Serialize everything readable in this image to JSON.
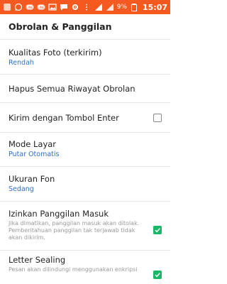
{
  "status_bar": {
    "left_icons": [
      "orange-square-icon",
      "whatsapp-icon",
      "line-icon",
      "line-chat-icon",
      "image-icon",
      "message-icon",
      "settings-icon",
      "menu-more-icon"
    ],
    "battery_percent": "9%",
    "time": "15:07",
    "background_color": "#f45a1f"
  },
  "header": {
    "title": "Obrolan & Panggilan"
  },
  "settings": {
    "photo_quality": {
      "title": "Kualitas Foto (terkirim)",
      "value": "Rendah"
    },
    "clear_history": {
      "title": "Hapus Semua Riwayat Obrolan"
    },
    "send_enter": {
      "title": "Kirim dengan Tombol Enter",
      "checked": false
    },
    "screen_mode": {
      "title": "Mode Layar",
      "value": "Putar Otomatis"
    },
    "font_size": {
      "title": "Ukuran Fon",
      "value": "Sedang"
    },
    "allow_calls": {
      "title": "Izinkan Panggilan Masuk",
      "description": "Jika dimatikan, panggilan masuk akan ditolak. Pemberitahuan panggilan tak terjawab tidak akan dikirim.",
      "checked": true
    },
    "letter_sealing": {
      "title": "Letter Sealing",
      "description": "Pesan akan dilindungi menggunakan enkripsi",
      "checked": true
    }
  },
  "colors": {
    "accent_blue": "#2f6fc6",
    "checkbox_green": "#19b866"
  }
}
